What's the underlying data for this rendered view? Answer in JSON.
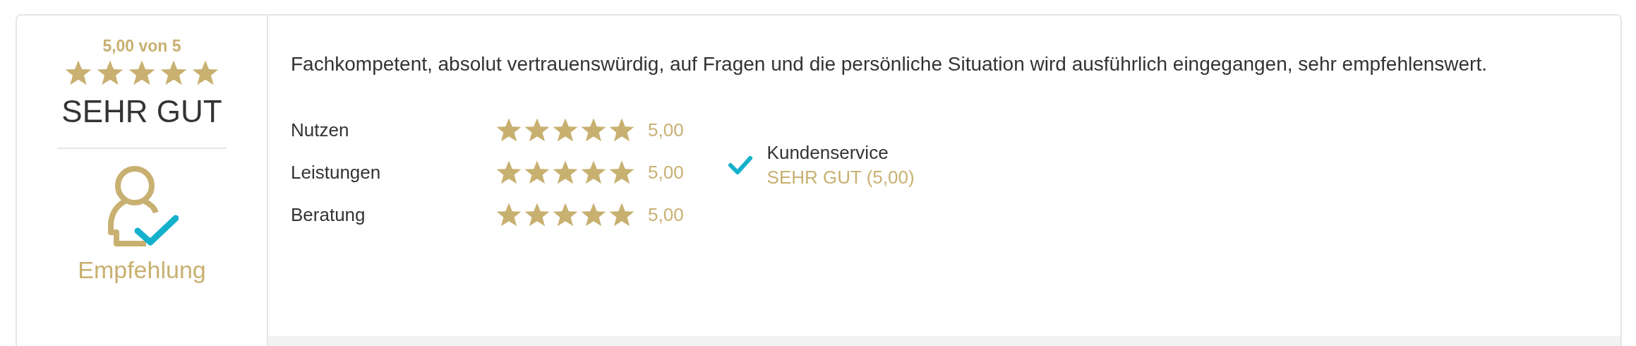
{
  "summary": {
    "score": "5,00 von 5",
    "stars": 5,
    "verdict": "SEHR GUT",
    "badge": {
      "label": "Empfehlung"
    }
  },
  "review": {
    "text": "Fachkompetent, absolut vertrauenswürdig, auf Fragen und die persönliche Situation wird ausführlich eingegangen, sehr empfehlenswert.",
    "ratings": [
      {
        "label": "Nutzen",
        "stars": 5,
        "value": "5,00"
      },
      {
        "label": "Leistungen",
        "stars": 5,
        "value": "5,00"
      },
      {
        "label": "Beratung",
        "stars": 5,
        "value": "5,00"
      }
    ],
    "highlight": {
      "label": "Kundenservice",
      "value": "SEHR GUT (5,00)"
    }
  }
}
